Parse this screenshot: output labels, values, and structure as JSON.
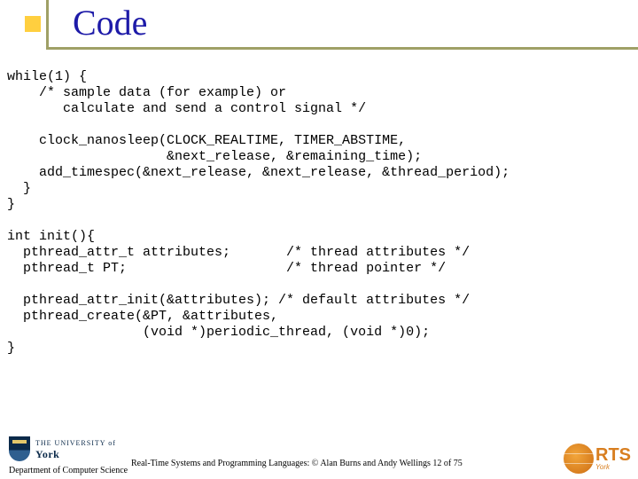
{
  "title": "Code",
  "code": "while(1) {\n    /* sample data (for example) or\n       calculate and send a control signal */\n\n    clock_nanosleep(CLOCK_REALTIME, TIMER_ABSTIME,\n                    &next_release, &remaining_time);\n    add_timespec(&next_release, &next_release, &thread_period);\n  }\n}\n\nint init(){\n  pthread_attr_t attributes;       /* thread attributes */\n  pthread_t PT;                    /* thread pointer */\n\n  pthread_attr_init(&attributes); /* default attributes */\n  pthread_create(&PT, &attributes,\n                 (void *)periodic_thread, (void *)0);\n}",
  "footer": {
    "university_top": "THE UNIVERSITY of",
    "university_name": "York",
    "department": "Department of Computer Science",
    "note": "Real-Time Systems and Programming Languages: © Alan Burns and Andy Wellings  12 of 75",
    "rts_label": "RTS",
    "rts_sub": "York"
  }
}
